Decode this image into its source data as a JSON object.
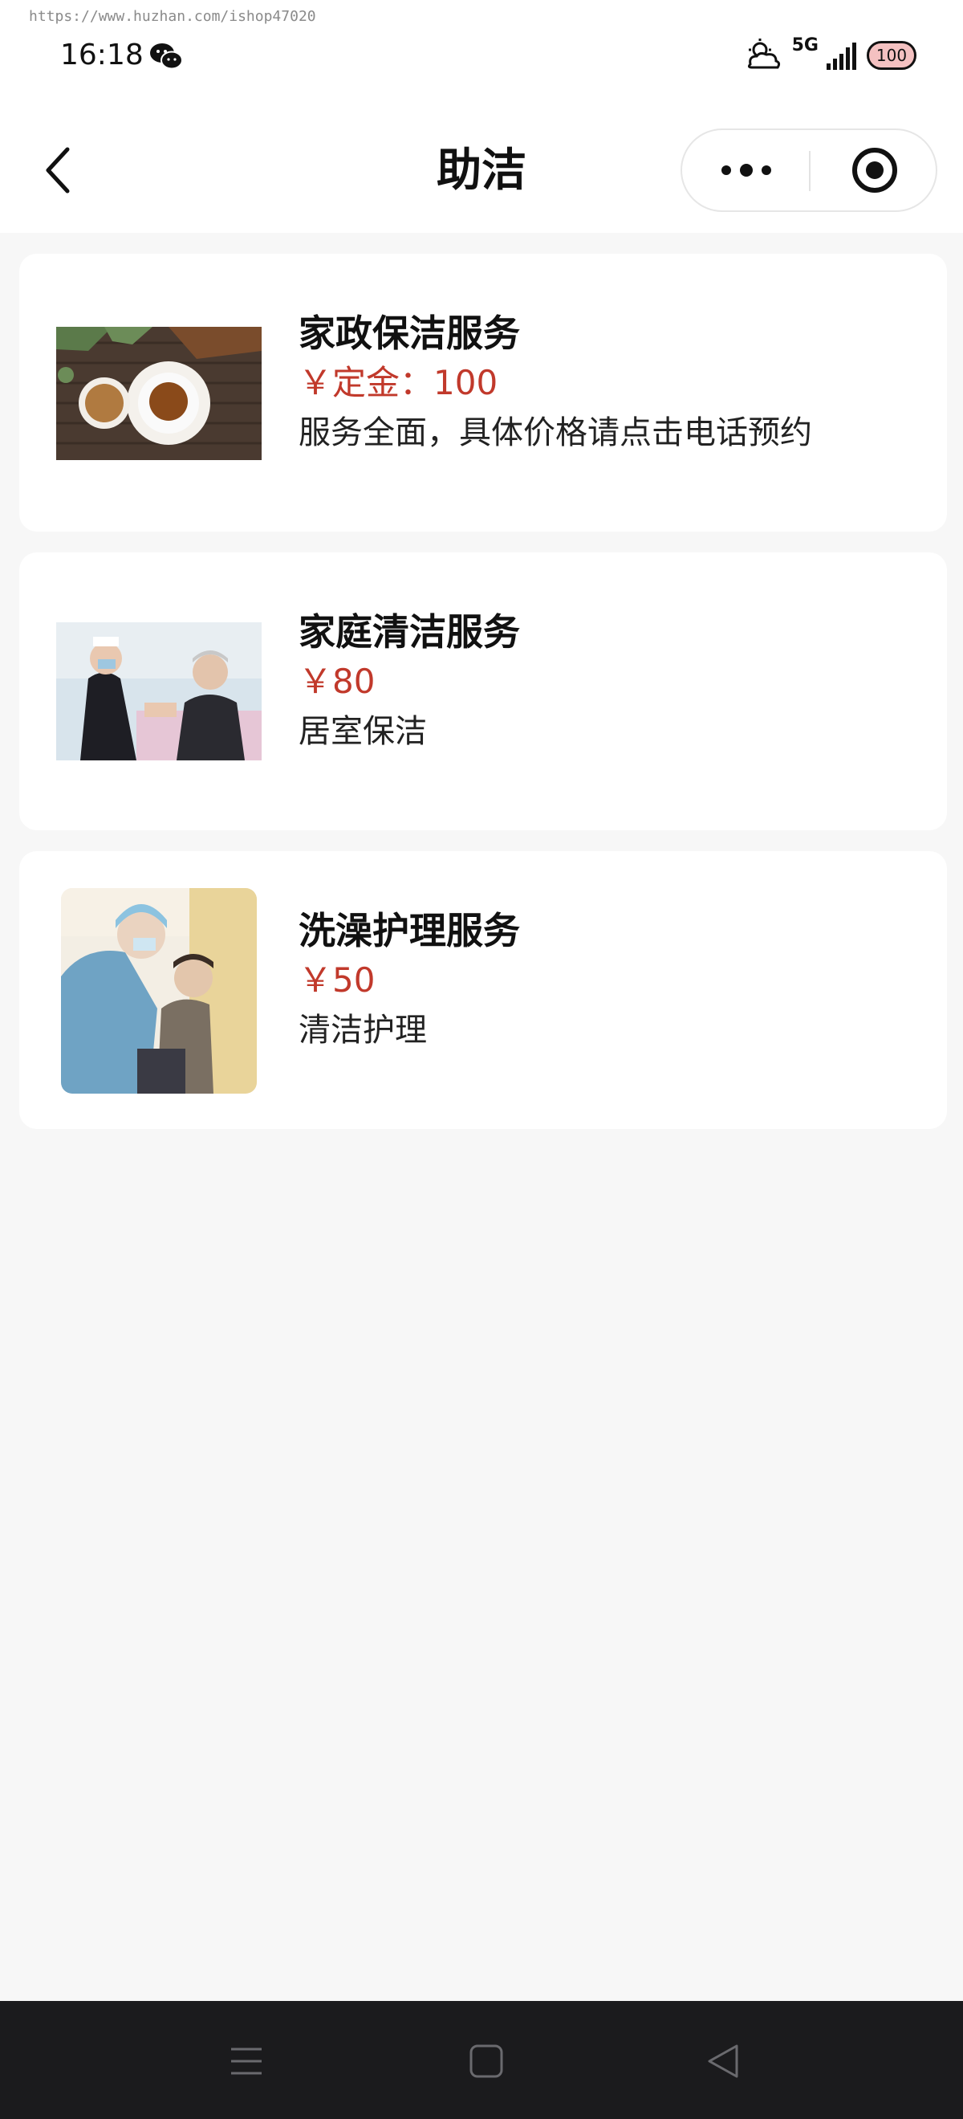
{
  "watermark": "https://www.huzhan.com/ishop47020",
  "status": {
    "time": "16:18",
    "network": "5G",
    "battery": "100"
  },
  "header": {
    "title": "助洁"
  },
  "services": [
    {
      "title": "家政保洁服务",
      "price": "￥定金：100",
      "desc": "服务全面，具体价格请点击电话预约"
    },
    {
      "title": "家庭清洁服务",
      "price": "￥80",
      "desc": "居室保洁"
    },
    {
      "title": "洗澡护理服务",
      "price": "￥50",
      "desc": "清洁护理"
    }
  ],
  "colors": {
    "price": "#c1392b",
    "background": "#f7f7f7",
    "nav_bar": "#1b1b1d"
  },
  "icons": [
    "wechat-icon",
    "weather-icon",
    "signal-icon",
    "battery-icon",
    "back-icon",
    "more-icon",
    "close-target-icon",
    "menu-icon",
    "home-icon",
    "back-triangle-icon"
  ]
}
